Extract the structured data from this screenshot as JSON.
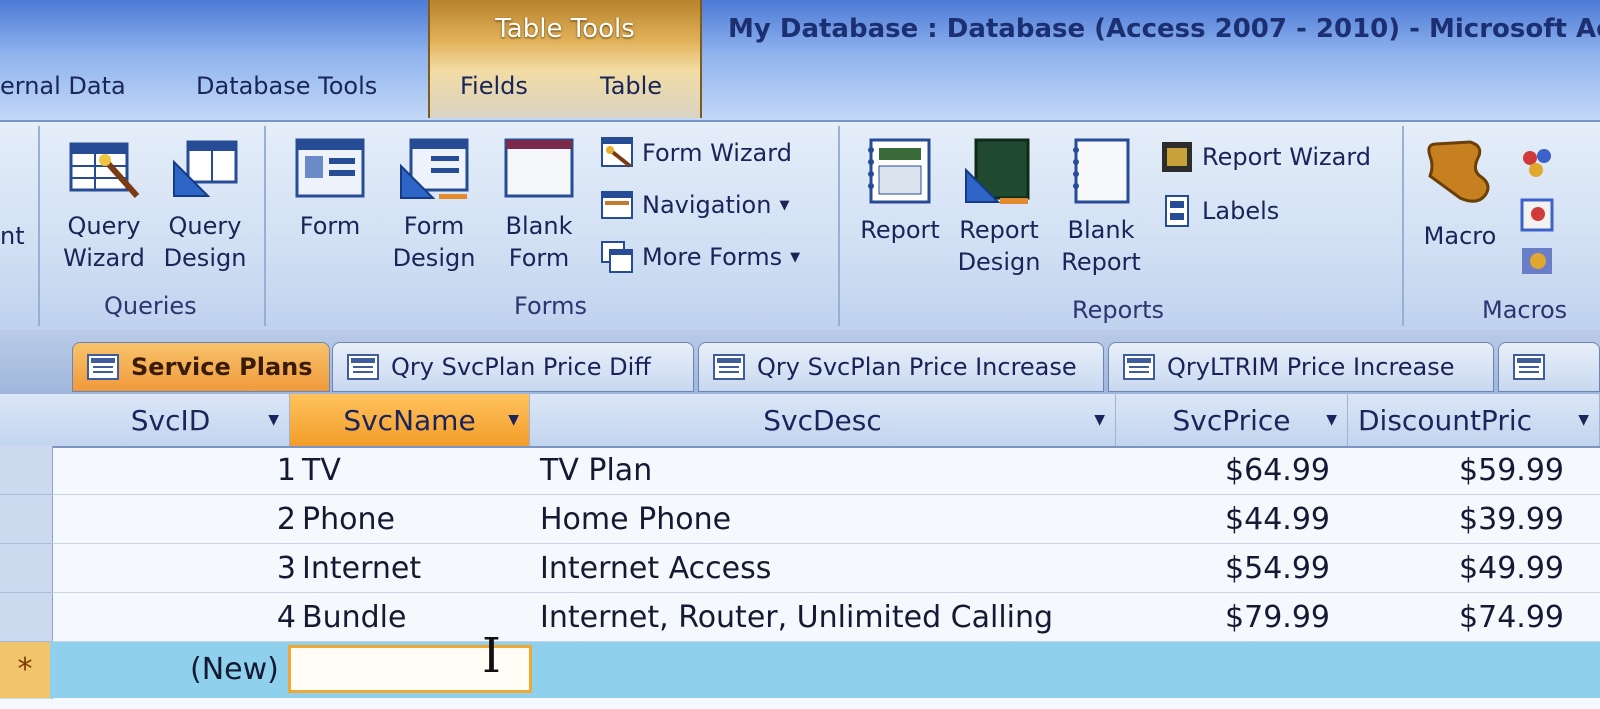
{
  "window": {
    "title": "My Database : Database (Access 2007 - 2010) - Microsoft Access",
    "context_group": "Table Tools"
  },
  "ribbon_tabs": [
    "ernal Data",
    "Database Tools",
    "Fields",
    "Table"
  ],
  "ribbon": {
    "partial_left": "nt",
    "queries": {
      "label": "Queries",
      "query_wizard": [
        "Query",
        "Wizard"
      ],
      "query_design": [
        "Query",
        "Design"
      ]
    },
    "forms": {
      "label": "Forms",
      "form": "Form",
      "form_design": [
        "Form",
        "Design"
      ],
      "blank_form": [
        "Blank",
        "Form"
      ],
      "form_wizard": "Form Wizard",
      "navigation": "Navigation",
      "more_forms": "More Forms"
    },
    "reports": {
      "label": "Reports",
      "report": "Report",
      "report_design": [
        "Report",
        "Design"
      ],
      "blank_report": [
        "Blank",
        "Report"
      ],
      "report_wizard": "Report Wizard",
      "labels": "Labels"
    },
    "macros": {
      "label": "Macros",
      "macro": "Macro"
    }
  },
  "doc_tabs": [
    "Service Plans",
    "Qry SvcPlan Price Diff",
    "Qry SvcPlan Price Increase",
    "QryLTRIM Price Increase"
  ],
  "table": {
    "columns": [
      "SvcID",
      "SvcName",
      "SvcDesc",
      "SvcPrice",
      "DiscountPric"
    ],
    "rows": [
      {
        "id": "1",
        "name": "TV",
        "desc": "TV Plan",
        "price": "$64.99",
        "discount": "$59.99"
      },
      {
        "id": "2",
        "name": "Phone",
        "desc": "Home Phone",
        "price": "$44.99",
        "discount": "$39.99"
      },
      {
        "id": "3",
        "name": "Internet",
        "desc": "Internet Access",
        "price": "$54.99",
        "discount": "$49.99"
      },
      {
        "id": "4",
        "name": "Bundle",
        "desc": "Internet, Router, Unlimited Calling",
        "price": "$79.99",
        "discount": "$74.99"
      }
    ],
    "new_row_label": "(New)",
    "new_row_marker": "*"
  },
  "colors": {
    "accent_orange": "#f39d2a",
    "ribbon_blue": "#d3e1f4",
    "new_row": "#8fd1ec"
  }
}
